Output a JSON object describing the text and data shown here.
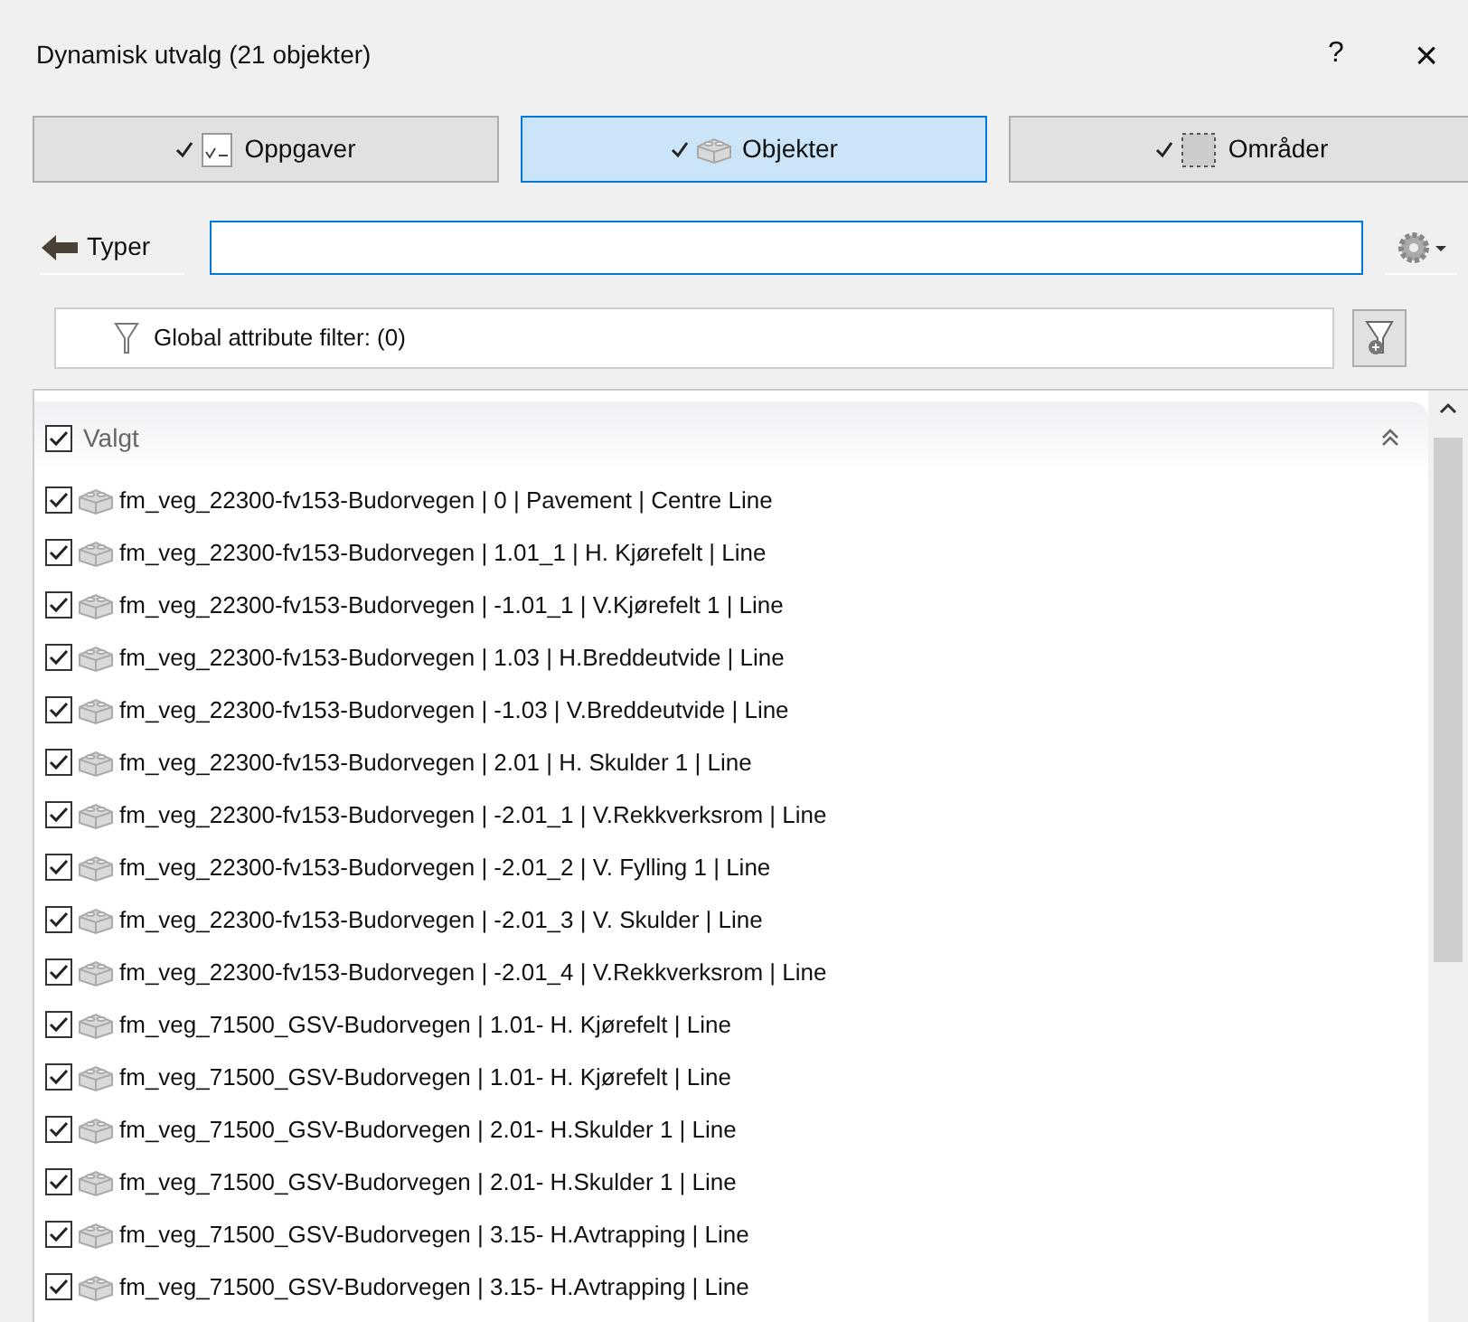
{
  "window": {
    "title": "Dynamisk utvalg (21 objekter)",
    "help": "?",
    "close": "×"
  },
  "tabs": [
    {
      "label": "Oppgaver",
      "kind": "tasks",
      "selected": false
    },
    {
      "label": "Objekter",
      "kind": "objects",
      "selected": true
    },
    {
      "label": "Områder",
      "kind": "areas",
      "selected": false
    }
  ],
  "back_button": {
    "label": "Typer"
  },
  "filter": {
    "label": "Global attribute filter: (0)"
  },
  "group": {
    "label": "Valgt",
    "checked": true,
    "expanded": true
  },
  "items": [
    {
      "label": "fm_veg_22300-fv153-Budorvegen | 0 | Pavement | Centre Line",
      "checked": true
    },
    {
      "label": "fm_veg_22300-fv153-Budorvegen | 1.01_1 | H. Kjørefelt | Line",
      "checked": true
    },
    {
      "label": "fm_veg_22300-fv153-Budorvegen | -1.01_1 | V.Kjørefelt 1 | Line",
      "checked": true
    },
    {
      "label": "fm_veg_22300-fv153-Budorvegen | 1.03 | H.Breddeutvide | Line",
      "checked": true
    },
    {
      "label": "fm_veg_22300-fv153-Budorvegen | -1.03 | V.Breddeutvide | Line",
      "checked": true
    },
    {
      "label": "fm_veg_22300-fv153-Budorvegen | 2.01 | H. Skulder 1 | Line",
      "checked": true
    },
    {
      "label": "fm_veg_22300-fv153-Budorvegen | -2.01_1 | V.Rekkverksrom | Line",
      "checked": true
    },
    {
      "label": "fm_veg_22300-fv153-Budorvegen | -2.01_2 | V. Fylling 1 | Line",
      "checked": true
    },
    {
      "label": "fm_veg_22300-fv153-Budorvegen | -2.01_3 | V. Skulder | Line",
      "checked": true
    },
    {
      "label": "fm_veg_22300-fv153-Budorvegen | -2.01_4 | V.Rekkverksrom | Line",
      "checked": true
    },
    {
      "label": "fm_veg_71500_GSV-Budorvegen | 1.01- H. Kjørefelt | Line",
      "checked": true
    },
    {
      "label": "fm_veg_71500_GSV-Budorvegen | 1.01- H. Kjørefelt | Line",
      "checked": true
    },
    {
      "label": "fm_veg_71500_GSV-Budorvegen | 2.01- H.Skulder 1 | Line",
      "checked": true
    },
    {
      "label": "fm_veg_71500_GSV-Budorvegen | 2.01- H.Skulder 1 | Line",
      "checked": true
    },
    {
      "label": "fm_veg_71500_GSV-Budorvegen | 3.15- H.Avtrapping | Line",
      "checked": true
    },
    {
      "label": "fm_veg_71500_GSV-Budorvegen | 3.15- H.Avtrapping | Line",
      "checked": true
    }
  ]
}
